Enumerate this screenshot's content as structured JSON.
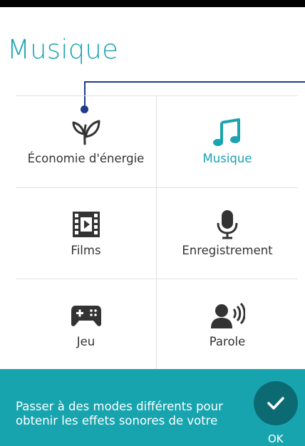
{
  "header": {
    "title": "Musique"
  },
  "modes": [
    {
      "label": "Économie d'énergie",
      "icon": "leaf-icon",
      "active": false
    },
    {
      "label": "Musique",
      "icon": "music-note-icon",
      "active": true
    },
    {
      "label": "Films",
      "icon": "film-icon",
      "active": false
    },
    {
      "label": "Enregistrement",
      "icon": "microphone-icon",
      "active": false
    },
    {
      "label": "Jeu",
      "icon": "gamepad-icon",
      "active": false
    },
    {
      "label": "Parole",
      "icon": "speaking-person-icon",
      "active": false
    }
  ],
  "footer": {
    "hint_line1": "Passer à des modes différents pour",
    "hint_line2": "obtenir les effets sonores de votre",
    "ok_label": "OK"
  },
  "colors": {
    "accent": "#1aa3b0",
    "footer_bg": "#18a4ae",
    "ok_button": "#0c6a73",
    "pointer": "#1e3c8a",
    "icon": "#333333"
  }
}
